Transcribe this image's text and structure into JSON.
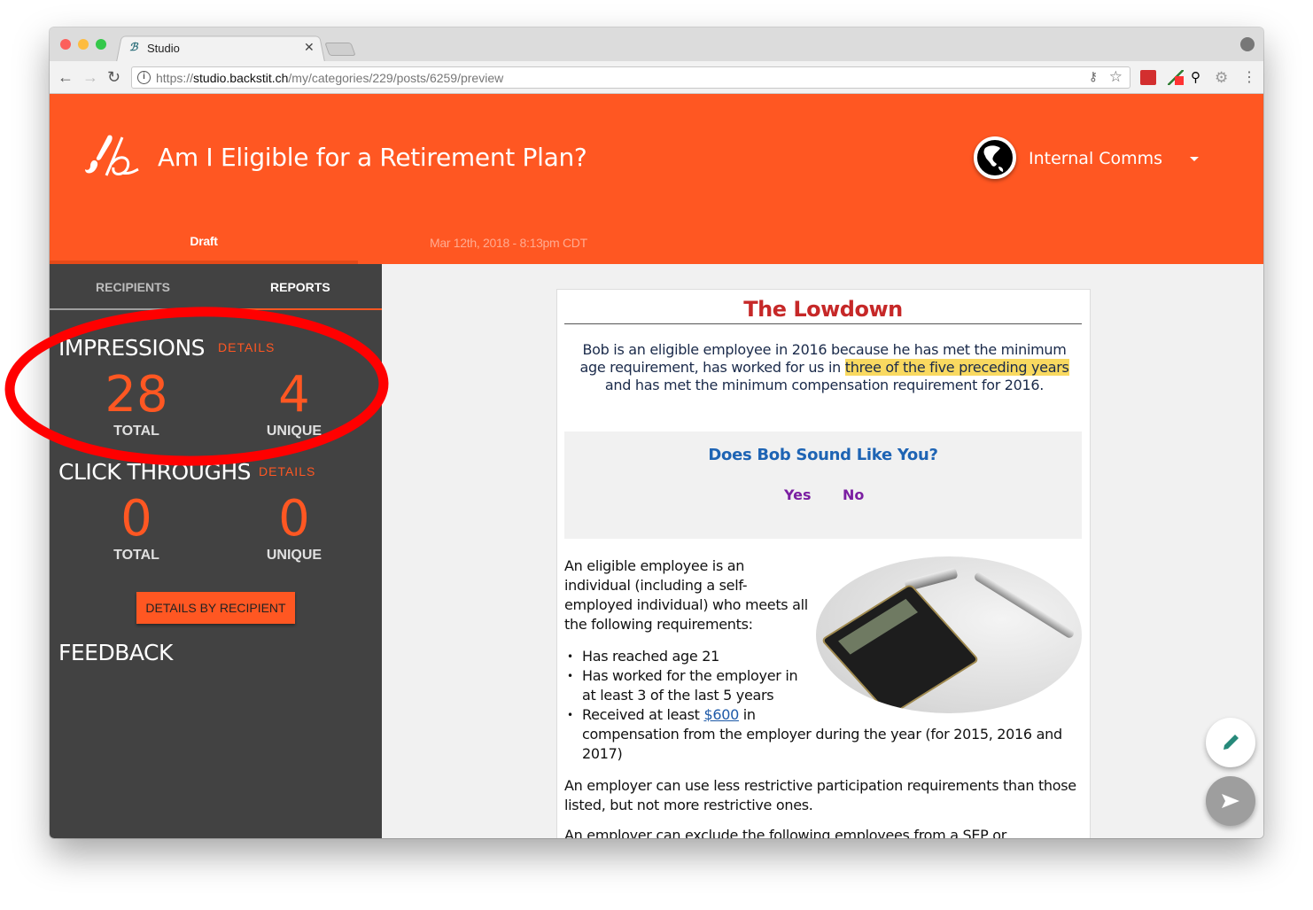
{
  "browser": {
    "tab_title": "Studio",
    "url_scheme": "https://",
    "url_host": "studio.backstit.ch",
    "url_path": "/my/categories/229/posts/6259/preview"
  },
  "header": {
    "title": "Am I Eligible for a Retirement Plan?",
    "organization": "Internal Comms",
    "status_tab": "Draft",
    "date": "Mar 12th, 2018 - 8:13pm CDT",
    "brand_color": "#ff5722"
  },
  "sidebar": {
    "tabs": [
      {
        "label": "RECIPIENTS"
      },
      {
        "label": "REPORTS"
      }
    ],
    "impressions": {
      "title": "IMPRESSIONS",
      "details": "DETAILS",
      "total": "28",
      "total_label": "TOTAL",
      "unique": "4",
      "unique_label": "UNIQUE"
    },
    "click_throughs": {
      "title": "CLICK THROUGHS",
      "details": "DETAILS",
      "total": "0",
      "total_label": "TOTAL",
      "unique": "0",
      "unique_label": "UNIQUE"
    },
    "details_button": "DETAILS BY RECIPIENT",
    "feedback": "FEEDBACK"
  },
  "email": {
    "heading": "The Lowdown",
    "intro_1": "Bob is an eligible employee in 2016 because he has met the minimum age requirement, has worked for us in ",
    "intro_highlight": "three of the five preceding years",
    "intro_2": " and has met the minimum compensation requirement for 2016.",
    "question": "Does Bob Sound Like You?",
    "yes": "Yes",
    "no": "No",
    "para1": "An eligible employee is an individual (including a self-employed individual) who meets all the following requirements:",
    "req1": "Has reached age 21",
    "req2": "Has worked for the employer in at least 3 of the last 5 years",
    "req3_a": "Received at least ",
    "req3_link": "$600",
    "req3_b": " in compensation from the employer during the year (for 2015, 2016 and 2017)",
    "para2": "An employer can use less restrictive participation requirements than those listed, but not more restrictive ones.",
    "para3": "An employer can exclude the following employees from a SEP or"
  },
  "icons": {
    "edit": "pencil-icon",
    "send": "send-icon",
    "org": "globe-icon"
  }
}
